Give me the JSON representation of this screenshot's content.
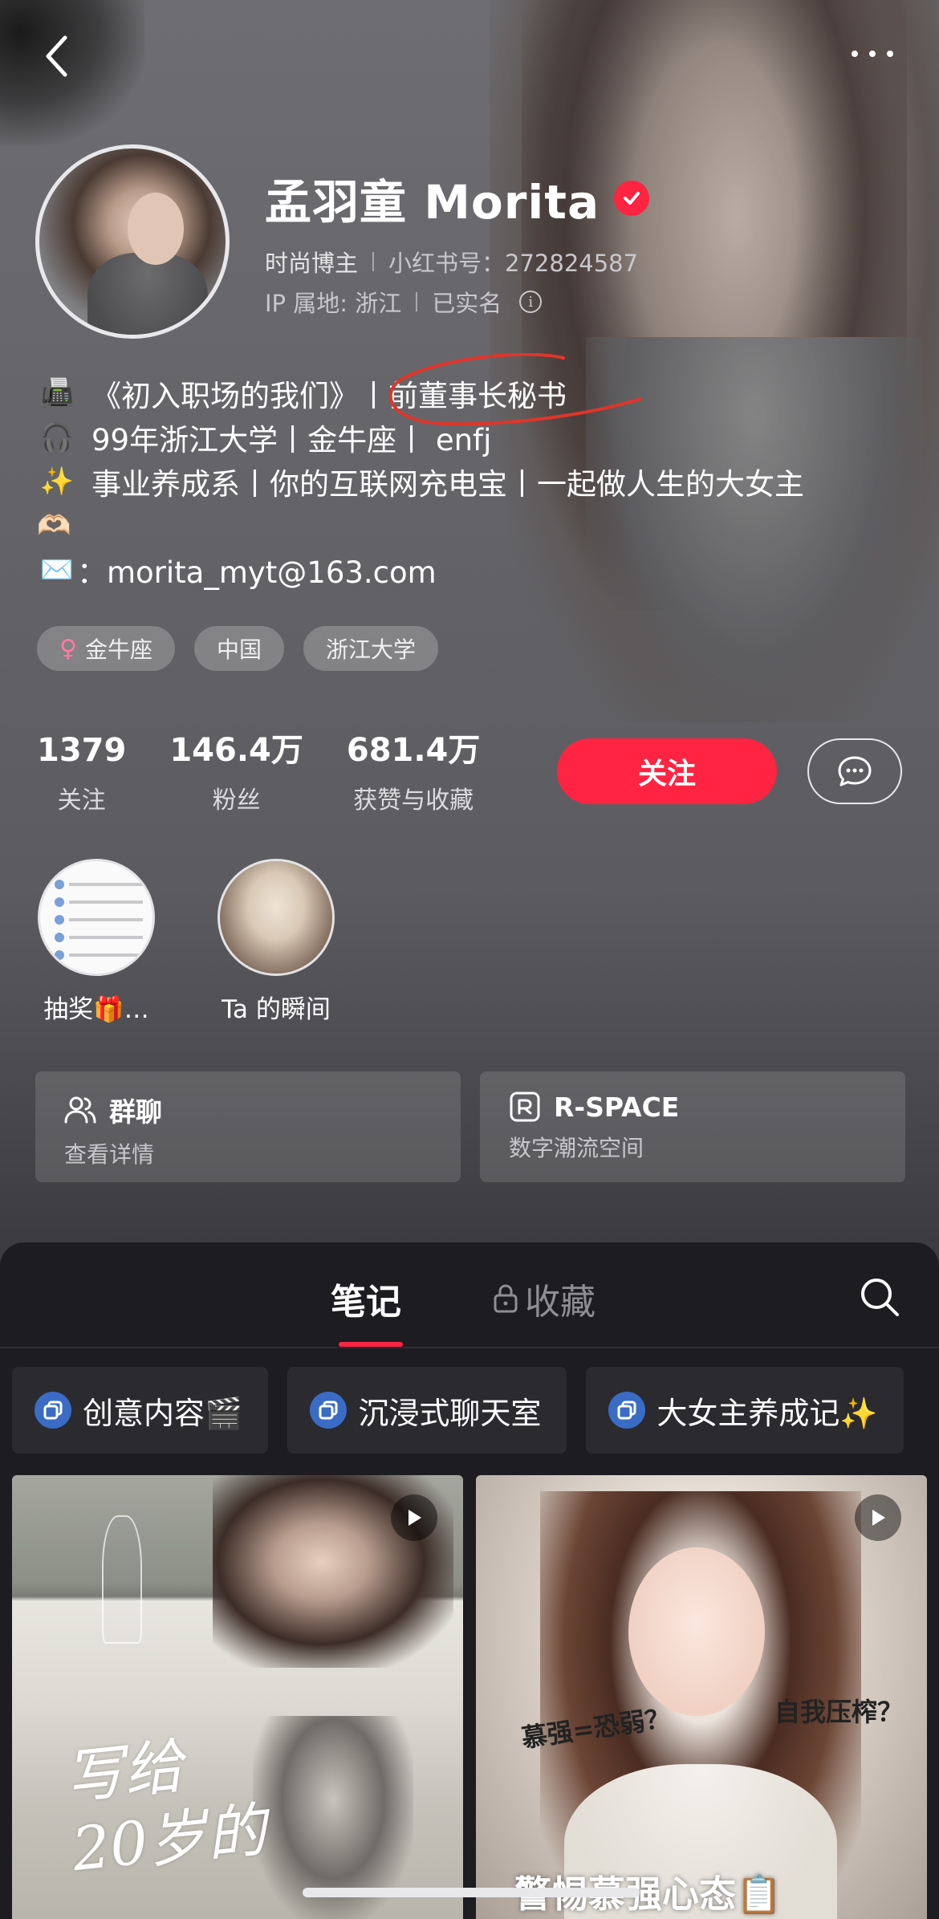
{
  "topbar": {
    "back_icon": "chevron-left-icon",
    "more_icon": "more-horizontal-icon"
  },
  "profile": {
    "name": "孟羽童 Morita",
    "verified": true,
    "category": "时尚博主",
    "xhs_id_label": "小红书号：272824587",
    "ip_label": "IP 属地: 浙江",
    "real_name": "已实名",
    "info_icon": "info-circle-icon"
  },
  "bio": {
    "line1_emoji": "📠",
    "line1_text": "《初入职场的我们》丨前董事长秘书",
    "line2_emoji": "🎧",
    "line2_text": "99年浙江大学丨金牛座丨 enfj",
    "line3_emoji": "✨",
    "line3_text": "事业养成系丨你的互联网充电宝丨一起做人生的大女主",
    "line4_emoji": "🫶🏻",
    "line5_emoji": "✉️",
    "line5_text": "：morita_myt@163.com",
    "annotation_color": "#e0352b"
  },
  "tags": [
    "金牛座",
    "中国",
    "浙江大学"
  ],
  "tag_female_icon": "♀",
  "stats": {
    "following_num": "1379",
    "following_label": "关注",
    "fans_num": "146.4万",
    "fans_label": "粉丝",
    "likes_num": "681.4万",
    "likes_label": "获赞与收藏"
  },
  "actions": {
    "follow_label": "关注",
    "message_icon": "message-bubble-icon",
    "brand_color": "#ff2442"
  },
  "highlights": [
    {
      "label": "抽奖🎁…"
    },
    {
      "label": "Ta 的瞬间"
    }
  ],
  "features": [
    {
      "title": "群聊",
      "subtitle": "查看详情",
      "icon": "group-people-icon"
    },
    {
      "title": "R-SPACE",
      "subtitle": "数字潮流空间",
      "icon": "r-space-icon"
    }
  ],
  "tabs": {
    "notes": "笔记",
    "collections": "收藏",
    "lock_icon": "lock-icon",
    "search_icon": "search-icon"
  },
  "chips": [
    {
      "label": "创意内容🎬"
    },
    {
      "label": "沉浸式聊天室"
    },
    {
      "label": "大女主养成记✨"
    }
  ],
  "notes": [
    {
      "overlay_text_1": "写给",
      "overlay_text_2": "20岁的",
      "video": true
    },
    {
      "caption_left": "慕强=恐弱？",
      "caption_right": "自我压榨？",
      "bottom_caption": "警惕慕强心态📋",
      "video": true
    }
  ]
}
